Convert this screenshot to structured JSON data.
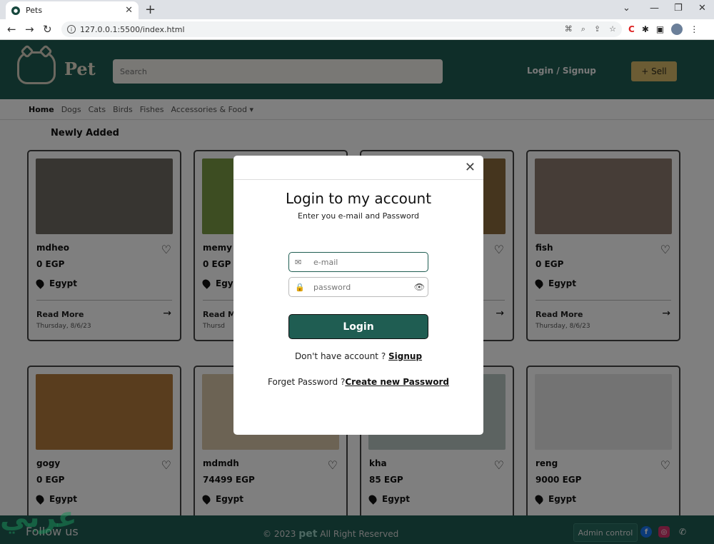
{
  "browser": {
    "tab_title": "Pets",
    "url": "127.0.0.1:5500/index.html"
  },
  "site": {
    "logo_text": "Pet",
    "search_placeholder": "Search",
    "login_signup": "Login / Signup",
    "sell_label": "+ Sell"
  },
  "nav": {
    "items": [
      "Home",
      "Dogs",
      "Cats",
      "Birds",
      "Fishes",
      "Accessories & Food"
    ]
  },
  "section_title": "Newly Added",
  "cards": [
    {
      "name": "mdheo",
      "price": "0 EGP",
      "location": "Egypt",
      "more": "Read More",
      "date": "Thursday, 8/6/23",
      "img": "#6f6a62"
    },
    {
      "name": "memy",
      "price": "0 EGP",
      "location": "Egy",
      "more": "Read Mo",
      "date": "Thursd",
      "img": "#7b9a45"
    },
    {
      "name": "",
      "price": "",
      "location": "",
      "more": "",
      "date": "",
      "img": "#8a6a3c"
    },
    {
      "name": "fish",
      "price": "0 EGP",
      "location": "Egypt",
      "more": "Read More",
      "date": "Thursday, 8/6/23",
      "img": "#8d7a6e"
    },
    {
      "name": "gogy",
      "price": "0 EGP",
      "location": "Egypt",
      "img": "#b27a3c"
    },
    {
      "name": "mdmdh",
      "price": "74499 EGP",
      "location": "Egypt",
      "img": "#d8c6a8"
    },
    {
      "name": "kha",
      "price": "85 EGP",
      "location": "Egypt",
      "img": "#b9c7c2"
    },
    {
      "name": "reng",
      "price": "9000 EGP",
      "location": "Egypt",
      "img": "#e7e7e7"
    }
  ],
  "footer": {
    "follow": "Follow us",
    "copyright_prefix": "© 2023",
    "brand": "pet",
    "copyright_suffix": "All Right Reserved",
    "admin_label": "Admin control"
  },
  "modal": {
    "title": "Login to my account",
    "subtitle": "Enter you e-mail and Password",
    "email_placeholder": "e-mail",
    "password_placeholder": "password",
    "login_label": "Login",
    "signup_prompt": "Don't have account ?",
    "signup_link": "Signup",
    "forgot_prompt": "Forget Password ?",
    "forgot_link": "Create new Password"
  },
  "watermark": "عربي"
}
